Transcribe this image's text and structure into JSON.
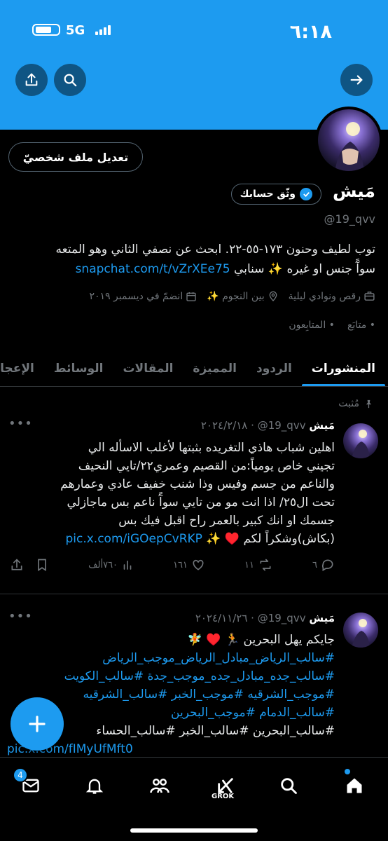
{
  "status_bar": {
    "time": "٦:١٨",
    "network": "5G"
  },
  "profile": {
    "name": "مَيش",
    "handle": "@19_qvv",
    "edit_label": "تعديل ملف شخصيّ",
    "verify_label": "وثّق حسابك",
    "bio_line1": "توب لطيف وحنون ١٧٣-٥٥-٢٢. ابحث عن نصفي الثاني وهو المتعه",
    "bio_line2_text": "سوآً جنس او غيره ✨ سنابي ",
    "bio_link": "snapchat.com/t/vZrXEe75",
    "category": "رقص ونوادي ليلية",
    "location": "بين النجوم ✨",
    "joined": "انضمّ في ديسمبر ٢٠١٩",
    "following_label": "متابَع",
    "followers_label": "المتابِعون"
  },
  "tabs": [
    "المنشورات",
    "الردود",
    "المميزة",
    "المقالات",
    "الوسائط",
    "الإعجابات"
  ],
  "posts": [
    {
      "pinned_label": "مُثبت",
      "name": "مَيش",
      "handle": "@19_qvv",
      "date": "٢٠٢٤/٢/١٨",
      "text_lines": [
        "اهلين شباب هاذي التغريده بثبتها لأغلب الاسأله الي",
        "تجيني خاص يومياً:من القصيم وعمري٢٢/تايي النحيف",
        "والناعم من جسم وفيس وذا شنب خفيف عادي وعمارهم",
        "تحت ال٢٥/ اذا انت مو من تايي سوآً ناعم بس ماجازلي",
        "جسمك او انك كبير بالعمر راح اقبل فيك بس"
      ],
      "last_line": "(بكاش)وشكراً لكم ♥️ ✨ ",
      "link": "pic.x.com/iGOepCvRKP",
      "replies": "٦",
      "retweets": "١١",
      "likes": "١٦١",
      "views": "٧٦٠ألف"
    },
    {
      "name": "مَيش",
      "handle": "@19_qvv",
      "date": "٢٠٢٤/١١/٢٦",
      "line1": "جايكم يهل البحرين 🏃 ♥️ 🧚",
      "hashtags": [
        "#سالب_الرياض_مبادل_الرياض_موجب_الرياض",
        "#سالب_جده_مبادل_جده_موجب_جدة #سالب_الكويت",
        "#موجب_الشرقيه #موجب_الخبر #سالب_الشرقيه",
        "#سالب_الدمام #موجب_البحرين"
      ],
      "line_plain": "#سالب_البحرين #سالب_الخبر #سالب_الحساء",
      "link": "pic.x.com/fIMyUfMft0"
    }
  ],
  "bottom_nav": {
    "messages_badge": "4",
    "grok_label": "GROK"
  },
  "colors": {
    "accent": "#1d9bf0",
    "background": "#000000",
    "muted": "#71767b"
  }
}
